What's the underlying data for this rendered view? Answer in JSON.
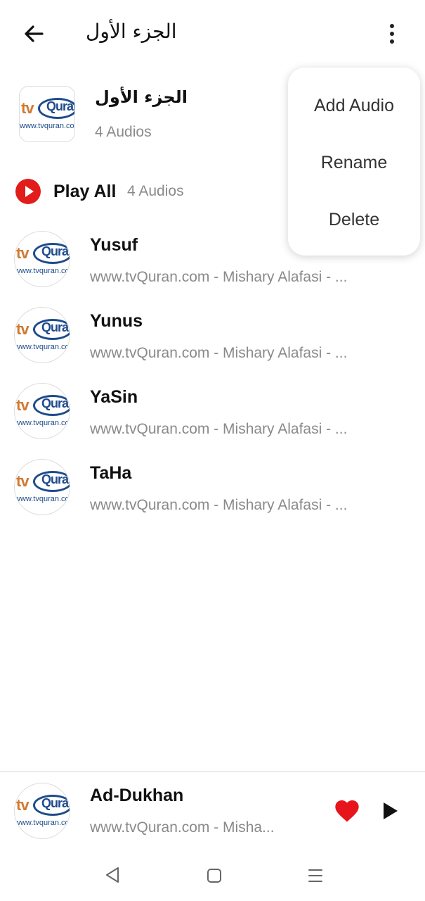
{
  "header": {
    "title": "الجزء الأول",
    "back_icon": "arrow-left-icon",
    "more_icon": "more-vertical-icon"
  },
  "playlist": {
    "name": "الجزء الأول",
    "count": "4 Audios",
    "logo": {
      "tv": "tv",
      "quran": "Quran",
      "url": "www.tvquran.com"
    }
  },
  "play_all": {
    "label": "Play All",
    "count": "4 Audios",
    "icon": "play-circle-icon"
  },
  "menu": {
    "items": [
      "Add Audio",
      "Rename",
      "Delete"
    ]
  },
  "tracks": [
    {
      "title": "Yusuf",
      "subtitle": "www.tvQuran.com - Mishary Alafasi - ..."
    },
    {
      "title": "Yunus",
      "subtitle": "www.tvQuran.com - Mishary Alafasi - ..."
    },
    {
      "title": "YaSin",
      "subtitle": "www.tvQuran.com - Mishary Alafasi - ..."
    },
    {
      "title": "TaHa",
      "subtitle": "www.tvQuran.com - Mishary Alafasi - ..."
    }
  ],
  "now_playing": {
    "title": "Ad-Dukhan",
    "subtitle": "www.tvQuran.com - Misha...",
    "favorite": true,
    "favorite_color": "#e8141c"
  },
  "colors": {
    "accent_red": "#e21b1b",
    "secondary_text": "#8a8a8a"
  }
}
